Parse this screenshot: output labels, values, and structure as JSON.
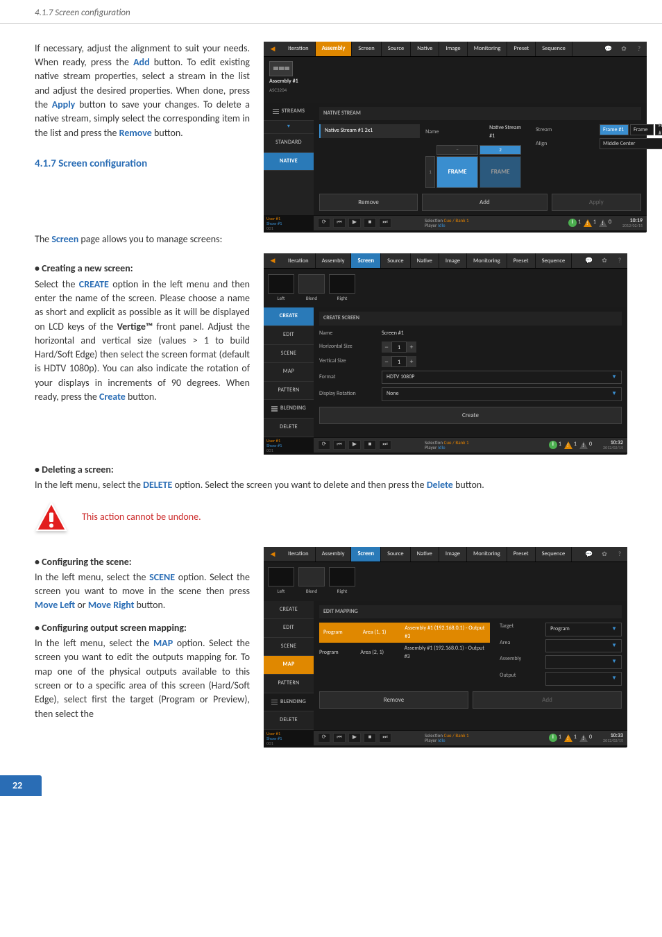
{
  "header": {
    "breadcrumb": "4.1.7 Screen configuration"
  },
  "intro": {
    "p1_a": "If necessary, adjust the alignment to suit your needs. When ready, press the ",
    "add": "Add",
    "p1_b": " button. To edit existing native stream properties, select a stream in the list and adjust the desired properties. When done, press the ",
    "apply": "Apply",
    "p1_c": " button to save your changes. To delete a native stream, simply select the corresponding item in the list and press the ",
    "remove": "Remove",
    "p1_d": " button."
  },
  "h1": "4.1.7 Screen configuration",
  "screen_intro_a": "The ",
  "screen_word": "Screen",
  "screen_intro_b": " page allows you to manage screens:",
  "creating": {
    "title": "• Creating a new screen:",
    "a": "Select the ",
    "create": "CREATE",
    "b": " option in the left menu and then enter the name of the screen. Please choose a name as short and explicit as possible as it will be displayed on LCD keys of the ",
    "vertige": "Vertige™",
    "c": " front panel. Adjust the horizontal and vertical size (values > 1 to build Hard/Soft Edge) then select the screen format (default is HDTV 1080p). You can also indicate the rotation of your displays in increments of 90 degrees. When ready, press the ",
    "create_btn": "Create",
    "d": " button."
  },
  "deleting": {
    "title": "• Deleting a screen:",
    "a": "In the left menu, select the ",
    "del": "DELETE",
    "b": " option. Select the screen you want to delete and then press the ",
    "del2": "Delete",
    "c": " button.",
    "warn": "This action cannot be undone."
  },
  "scene_cfg": {
    "title": "• Configuring the scene:",
    "a": "In the left menu, select the ",
    "scene": "SCENE",
    "b": " option. Select the screen you want to move in the scene then press ",
    "ml": "Move Left",
    "c": " or ",
    "mr": "Move Right",
    "d": " button."
  },
  "map_cfg": {
    "title": "• Configuring output screen mapping:",
    "a": "In the left menu, select the ",
    "map": "MAP",
    "b": " option. Select the screen you want to edit the outputs mapping for. To map one of the physical outputs available to this screen or to a specific area of this screen (Hard/Soft Edge), select first the target (Program or Preview), then select the"
  },
  "page_number": "22",
  "topnav": {
    "tabs": [
      "Iteration",
      "Assembly",
      "Screen",
      "Source",
      "Native",
      "Image",
      "Monitoring",
      "Preset",
      "Sequence"
    ]
  },
  "app1": {
    "asm_label": "Assembly #1",
    "asm_sub": "ASC3204",
    "side_head": "STREAMS",
    "side": [
      "STANDARD",
      "NATIVE"
    ],
    "panel_title": "NATIVE STREAM",
    "stream_item": "Native Stream #1 2x1",
    "name_lab": "Name",
    "name_val": "Native Stream #1",
    "hnum_top": "2",
    "hnum_left": "1",
    "frame": "FRAME",
    "stream_lab": "Stream",
    "stream_sel": "Frame #1",
    "stream_sel2": "Frame",
    "stream_sel3": "Frame #",
    "align_lab": "Align",
    "align_val": "Middle Center",
    "remove_btn": "Remove",
    "add_btn": "Add",
    "apply_btn": "Apply",
    "foot_l1": "User #1",
    "foot_l2": "Show #1",
    "foot_l3": "001",
    "sel_lab": "Selection",
    "sel_val": "Cue / Bank 1",
    "player_lab": "Player",
    "player_val": "Idle",
    "clock": "10:19",
    "clock_sub": "2012/02/15"
  },
  "app2": {
    "thumbs": [
      "Left",
      "Blend",
      "Right"
    ],
    "side": [
      "CREATE",
      "EDIT",
      "SCENE",
      "MAP",
      "PATTERN",
      "BLENDING",
      "DELETE"
    ],
    "panel_title": "CREATE SCREEN",
    "name_lab": "Name",
    "name_val": "Screen #1",
    "hsize_lab": "Horizontal Size",
    "hsize_val": "1",
    "vsize_lab": "Vertical Size",
    "vsize_val": "1",
    "format_lab": "Format",
    "format_val": "HDTV 1080P",
    "rot_lab": "Display Rotation",
    "rot_val": "None",
    "create_btn": "Create",
    "clock": "10:32",
    "clock_sub": "2012/02/15"
  },
  "app3": {
    "panel_title": "EDIT MAPPING",
    "row1_a": "Program",
    "row1_b": "Area (1, 1)",
    "row1_c": "Assembly #1 (192.168.0.1) - Output #3",
    "row2_a": "Program",
    "row2_b": "Area (2, 1)",
    "row2_c": "Assembly #1 (192.168.0.1) - Output #3",
    "r_target": "Target",
    "r_target_v": "Program",
    "r_area": "Area",
    "r_asm": "Assembly",
    "r_out": "Output",
    "remove_btn": "Remove",
    "add_btn": "Add",
    "clock": "10:33",
    "clock_sub": "2012/02/15"
  }
}
